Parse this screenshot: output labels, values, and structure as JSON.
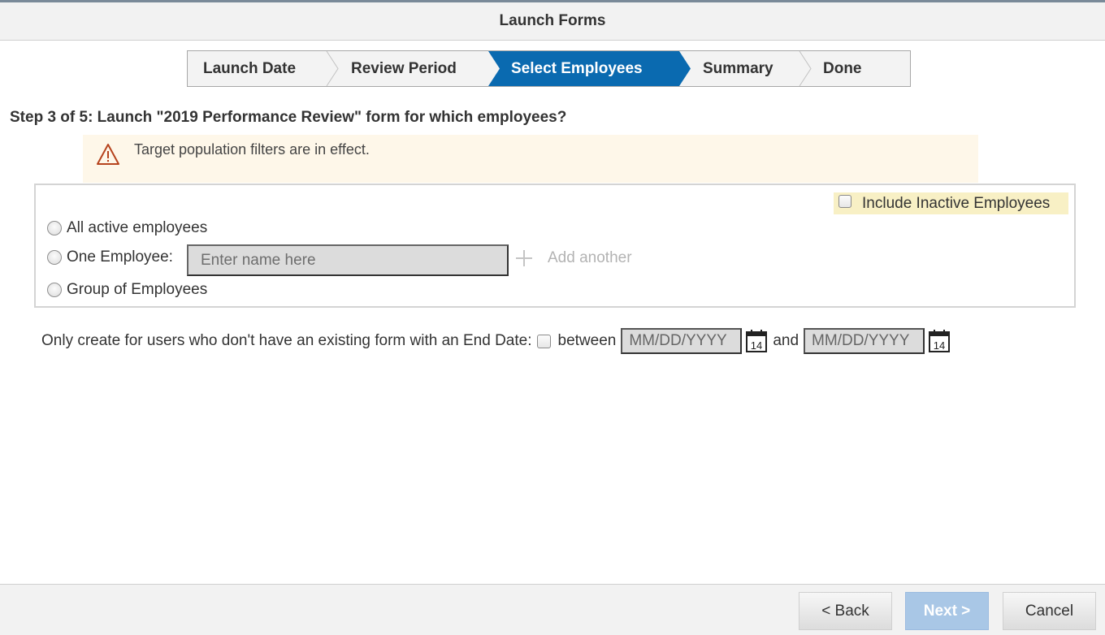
{
  "dialog": {
    "title": "Launch Forms"
  },
  "wizard": {
    "steps": [
      {
        "label": "Launch Date",
        "active": false
      },
      {
        "label": "Review Period",
        "active": false
      },
      {
        "label": "Select Employees",
        "active": true
      },
      {
        "label": "Summary",
        "active": false
      },
      {
        "label": "Done",
        "active": false
      }
    ],
    "active_color": "#0a6ab0"
  },
  "step_heading": "Step 3 of 5: Launch \"2019 Performance Review\" form for which employees?",
  "warning": {
    "icon": "warning-triangle-icon",
    "text": "Target population filters are in effect.",
    "color": "#b6431d"
  },
  "options": {
    "include_inactive_label": "Include Inactive Employees",
    "include_inactive_checked": false,
    "radios": [
      {
        "label": "All active employees",
        "selected": false
      },
      {
        "label": "One Employee:",
        "selected": false
      },
      {
        "label": "Group of Employees",
        "selected": false
      }
    ],
    "name_placeholder": "Enter name here",
    "name_value": "",
    "add_another_label": "Add another"
  },
  "date_filter": {
    "label": "Only create for users who don't have an existing form with an End Date:",
    "checked": false,
    "between_label": "between",
    "from_placeholder": "MM/DD/YYYY",
    "and_label": "and",
    "to_placeholder": "MM/DD/YYYY",
    "calendar_day": "14"
  },
  "footer": {
    "back_label": "< Back",
    "next_label": "Next >",
    "cancel_label": "Cancel"
  }
}
